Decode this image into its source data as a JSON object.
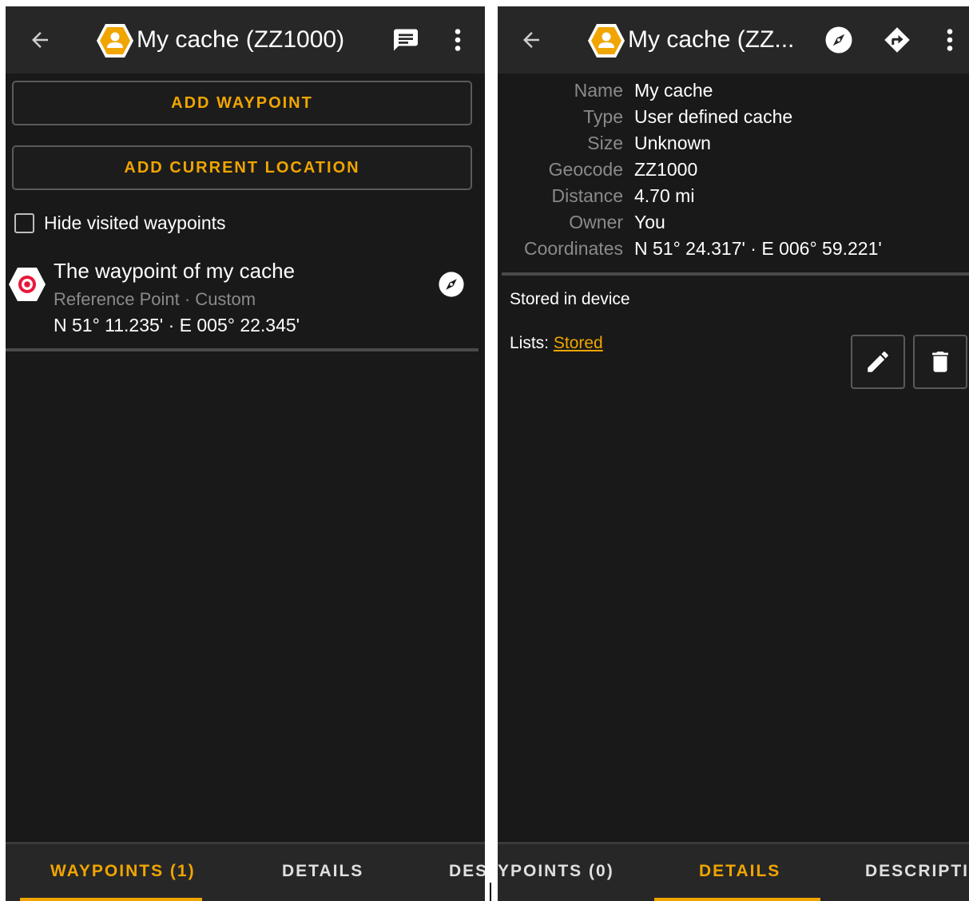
{
  "colors": {
    "accent": "#f0a500",
    "background": "#191919",
    "appbar": "#272727",
    "secondary_text": "#8a8a8a",
    "waypoint_marker": "#e8173a"
  },
  "left_screen": {
    "appbar": {
      "title": "My cache (ZZ1000)",
      "icons": [
        "back-arrow-icon",
        "cache-type-icon",
        "comment-icon",
        "more-vert-icon"
      ]
    },
    "add_waypoint_label": "ADD WAYPOINT",
    "add_location_label": "ADD CURRENT LOCATION",
    "hide_visited": {
      "label": "Hide visited waypoints",
      "checked": false
    },
    "waypoint": {
      "title": "The waypoint of my cache",
      "subtitle": "Reference Point · Custom",
      "coords": "N 51° 11.235' · E 005° 22.345'",
      "icons": [
        "reference-point-icon",
        "compass-icon"
      ]
    },
    "tabs": [
      {
        "label": "WAYPOINTS (1)",
        "active": true
      },
      {
        "label": "DETAILS",
        "active": false
      },
      {
        "label": "DES",
        "active": false
      }
    ]
  },
  "right_screen": {
    "appbar": {
      "title": "My cache (ZZ...",
      "icons": [
        "back-arrow-icon",
        "cache-type-icon",
        "compass-icon",
        "navigate-icon",
        "more-vert-icon"
      ]
    },
    "details": [
      {
        "label": "Name",
        "value": "My cache"
      },
      {
        "label": "Type",
        "value": "User defined cache"
      },
      {
        "label": "Size",
        "value": "Unknown"
      },
      {
        "label": "Geocode",
        "value": "ZZ1000"
      },
      {
        "label": "Distance",
        "value": "4.70 mi"
      },
      {
        "label": "Owner",
        "value": "You"
      },
      {
        "label": "Coordinates",
        "value": "N 51° 24.317' · E 006° 59.221'"
      }
    ],
    "stored_text": "Stored in device",
    "lists_label": "Lists:",
    "lists_value": "Stored",
    "action_icons": [
      "edit-icon",
      "delete-icon"
    ],
    "tabs": [
      {
        "label": "YPOINTS (0)",
        "active": false
      },
      {
        "label": "DETAILS",
        "active": true
      },
      {
        "label": "DESCRIPTIO",
        "active": false
      }
    ]
  }
}
